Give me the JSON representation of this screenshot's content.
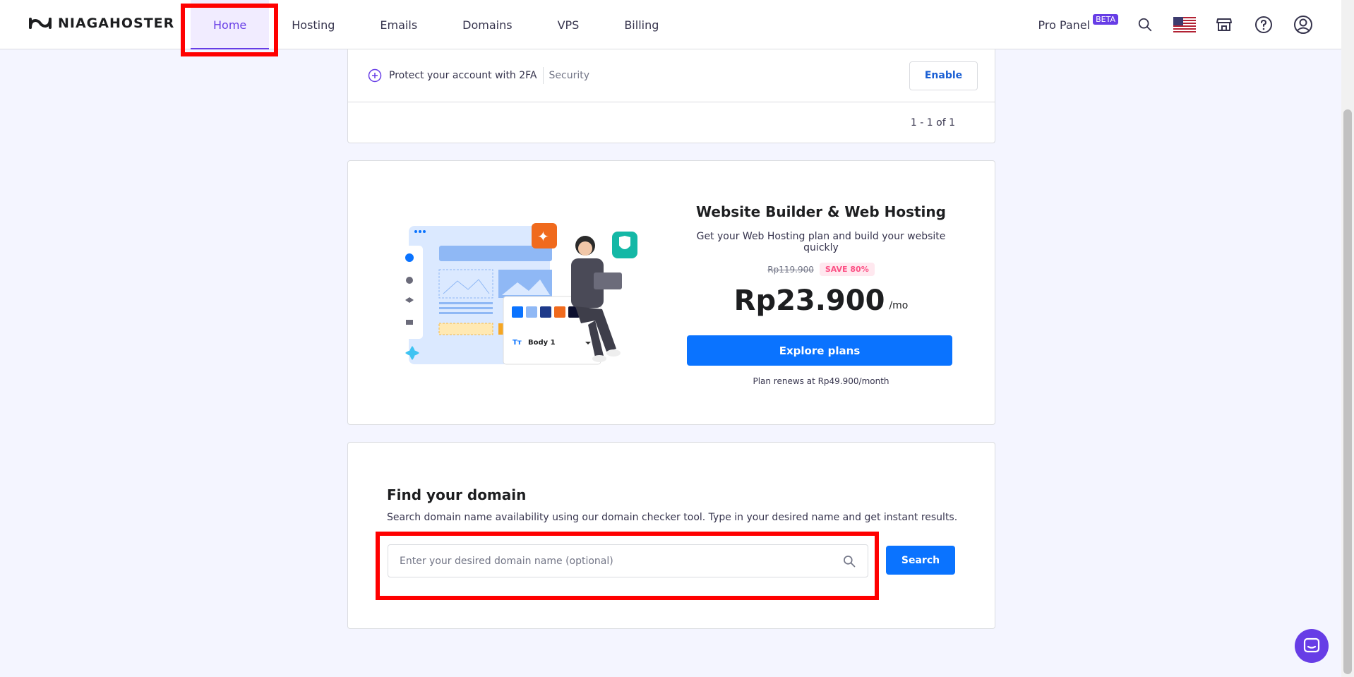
{
  "brand": {
    "name": "NIAGAHOSTER"
  },
  "nav": {
    "items": [
      {
        "label": "Home",
        "active": true
      },
      {
        "label": "Hosting"
      },
      {
        "label": "Emails"
      },
      {
        "label": "Domains"
      },
      {
        "label": "VPS"
      },
      {
        "label": "Billing"
      }
    ]
  },
  "header_right": {
    "pro_panel": "Pro Panel",
    "beta": "BETA",
    "icons": [
      "search-icon",
      "flag-us-icon",
      "store-icon",
      "help-icon",
      "account-icon"
    ]
  },
  "security_row": {
    "text": "Protect your account with 2FA",
    "category": "Security",
    "button": "Enable",
    "pagination": "1 - 1 of 1"
  },
  "promo": {
    "title": "Website Builder & Web Hosting",
    "subtitle": "Get your Web Hosting plan and build your website quickly",
    "old_price": "Rp119.900",
    "save_badge": "SAVE 80%",
    "price": "Rp23.900",
    "period": "/mo",
    "cta": "Explore plans",
    "renew_note": "Plan renews at Rp49.900/month",
    "illustration": {
      "font_label": "Body 1",
      "swatches": [
        "#0a73ff",
        "#8fb8f5",
        "#1e3a8a",
        "#f06a1d",
        "#0c0f2e"
      ]
    }
  },
  "domain": {
    "title": "Find your domain",
    "description": "Search domain name availability using our domain checker tool. Type in your desired name and get instant results.",
    "placeholder": "Enter your desired domain name (optional)",
    "button": "Search"
  },
  "colors": {
    "accent": "#673de6",
    "primary_button": "#0a73ff",
    "highlight": "#ff0000"
  }
}
